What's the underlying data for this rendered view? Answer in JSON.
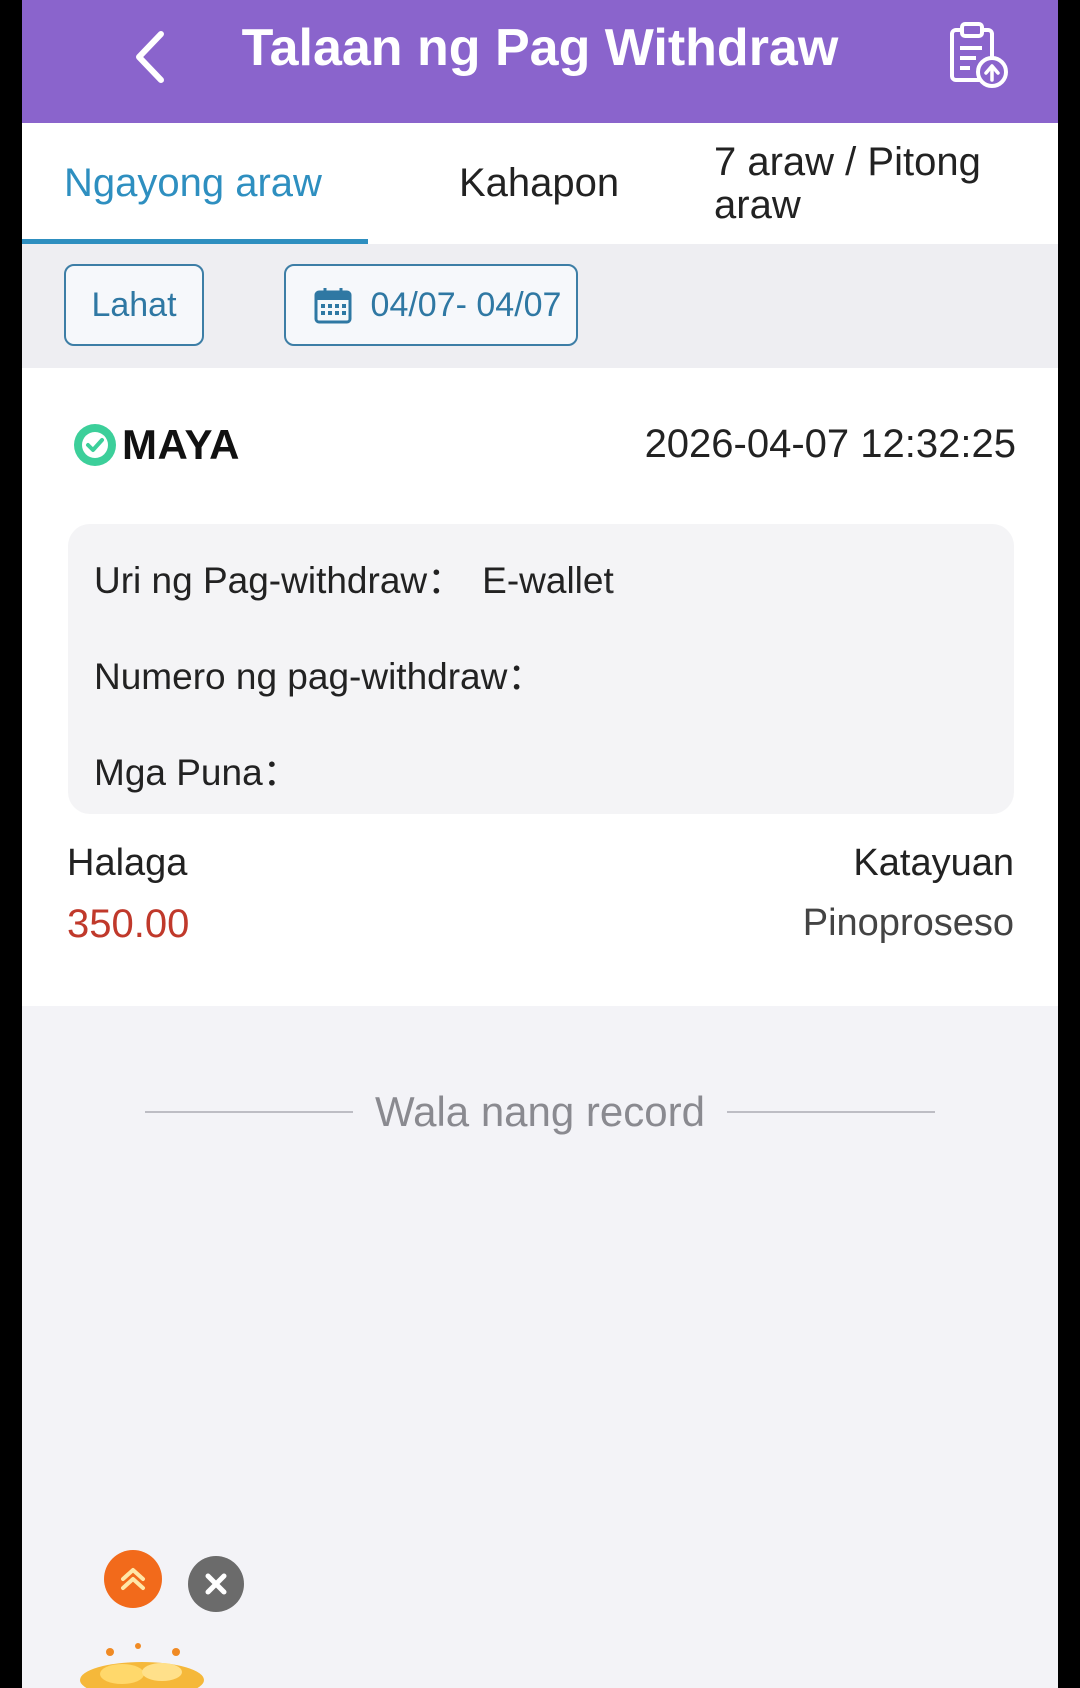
{
  "header": {
    "title": "Talaan ng Pag Withdraw",
    "back_icon": "chevron-left-icon",
    "record_icon": "clipboard-upload-icon"
  },
  "tabs": [
    {
      "label": "Ngayong araw",
      "active": true
    },
    {
      "label": "Kahapon",
      "active": false
    },
    {
      "label": "7 araw / Pitong araw",
      "active": false
    }
  ],
  "filters": {
    "all_label": "Lahat",
    "date_range": "04/07- 04/07",
    "calendar_icon": "calendar-icon"
  },
  "record": {
    "provider": "MAYA",
    "provider_icon": "maya-logo-icon",
    "datetime": "2026-04-07 12:32:25",
    "type_label": "Uri ng Pag-withdraw：",
    "type_value": "E-wallet",
    "number_label": "Numero ng pag-withdraw：",
    "remarks_label": "Mga Puna：",
    "amount_label": "Halaga",
    "amount_value": "350.00",
    "status_label": "Katayuan",
    "status_value": "Pinoproseso"
  },
  "footer": {
    "no_more_records": "Wala nang record"
  },
  "colors": {
    "header_bg": "#8a64cc",
    "accent": "#2e8fc0",
    "amount": "#c0392b"
  }
}
